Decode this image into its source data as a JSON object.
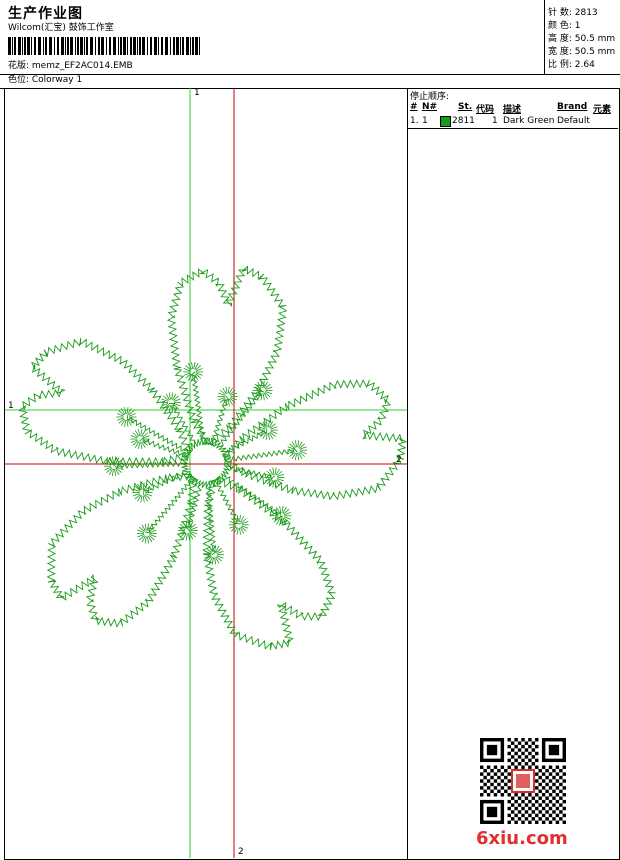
{
  "header": {
    "title": "生产作业图",
    "company": "Wilcom(汇宝) 鼓饰工作室",
    "design_line": "花版: memz_EF2AC014.EMB",
    "colorway_line": "色位: Colorway 1"
  },
  "stats": {
    "stitches": "针 数: 2813",
    "colors": "颜 色: 1",
    "height": "高 度: 50.5 mm",
    "width": "宽 度: 50.5 mm",
    "scale": "比 例: 2.64"
  },
  "stop_sequence": {
    "title": "停止顺序:",
    "columns": [
      "#",
      "N#",
      "St.",
      "代码",
      "描述",
      "Brand",
      "元素"
    ],
    "rows": [
      {
        "index": "1.",
        "n": "1",
        "stitches": "2811",
        "code": "1",
        "description": "Dark Green",
        "brand": "Default",
        "color": "#1a9a1a"
      }
    ]
  },
  "axes": {
    "green_v": "1",
    "green_h": "1",
    "red_h": "2",
    "red_v": "2"
  },
  "colors": {
    "thread": "#1a9a1a",
    "axis_green": "#33cc33",
    "axis_red": "#cc0000"
  },
  "watermark": {
    "text": "6xiu.com"
  }
}
